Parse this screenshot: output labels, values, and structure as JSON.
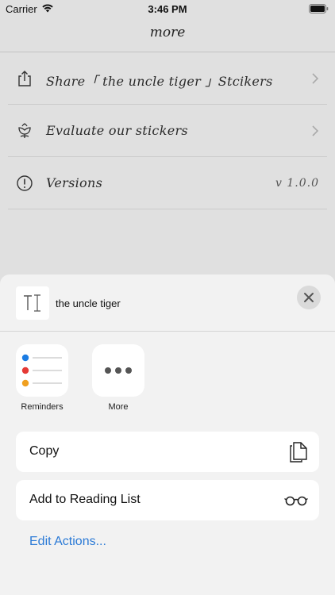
{
  "status_bar": {
    "carrier": "Carrier",
    "time": "3:46 PM"
  },
  "app": {
    "title": "more",
    "rows": [
      {
        "label": "Share「 the uncle tiger 」Stcikers",
        "icon": "share-icon",
        "accessory": "chevron"
      },
      {
        "label": "Evaluate our stickers",
        "icon": "flower-icon",
        "accessory": "chevron"
      },
      {
        "label": "Versions",
        "icon": "info-icon",
        "value": "v 1.0.0"
      }
    ]
  },
  "share_sheet": {
    "preview_title": "the uncle tiger",
    "apps": [
      {
        "label": "Reminders",
        "icon": "reminders-icon"
      },
      {
        "label": "More",
        "icon": "more-icon"
      }
    ],
    "actions": [
      {
        "label": "Copy",
        "icon": "copy-icon"
      },
      {
        "label": "Add to Reading List",
        "icon": "glasses-icon"
      }
    ],
    "edit_actions_label": "Edit Actions...",
    "accent_color": "#2b7ad6",
    "reminder_colors": [
      "#1b7ce3",
      "#e53935",
      "#f0a020"
    ]
  }
}
